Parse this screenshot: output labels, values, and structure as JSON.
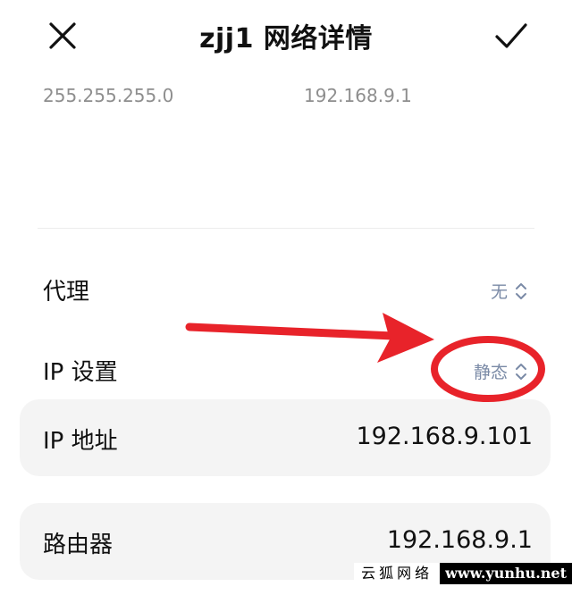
{
  "header": {
    "title": "zjj1 网络详情",
    "close_icon": "close-icon",
    "confirm_icon": "check-icon"
  },
  "subnet": {
    "mask": "255.255.255.0",
    "gateway": "192.168.9.1"
  },
  "proxy": {
    "label": "代理",
    "value": "无"
  },
  "ip_settings": {
    "label": "IP 设置",
    "value": "静态"
  },
  "ip_address": {
    "label": "IP 地址",
    "value": "192.168.9.101"
  },
  "router": {
    "label": "路由器",
    "value": "192.168.9.1"
  },
  "annotation": {
    "color": "#e8232a"
  },
  "watermark": {
    "cn": "云狐网络",
    "url": "www.yunhu.net"
  },
  "colors": {
    "value_accent": "#7a8aa6",
    "card_bg": "#f4f4f4"
  }
}
